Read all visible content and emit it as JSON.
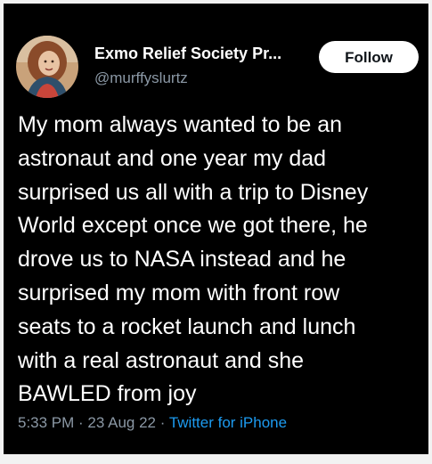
{
  "tweet": {
    "author": {
      "display_name": "Exmo Relief Society Pr...",
      "handle": "@murffyslurtz"
    },
    "follow_label": "Follow",
    "text": "My mom always wanted to be an\nastronaut and one year my dad\nsurprised us all with a trip to Disney\nWorld except once we got there, he\ndrove us to NASA instead and he\nsurprised my mom with front row\nseats to a rocket launch and lunch\nwith a real astronaut and she\nBAWLED from joy",
    "time": "5:33 PM",
    "separator": " · ",
    "date": "23 Aug 22",
    "source": "Twitter for iPhone"
  },
  "colors": {
    "background": "#000000",
    "text": "#ffffff",
    "secondary_text": "#8b98a5",
    "link": "#1d9bf0",
    "follow_button_bg": "#ffffff",
    "follow_button_text": "#0f1419"
  },
  "icons": {
    "avatar": "profile-photo-avatar"
  }
}
